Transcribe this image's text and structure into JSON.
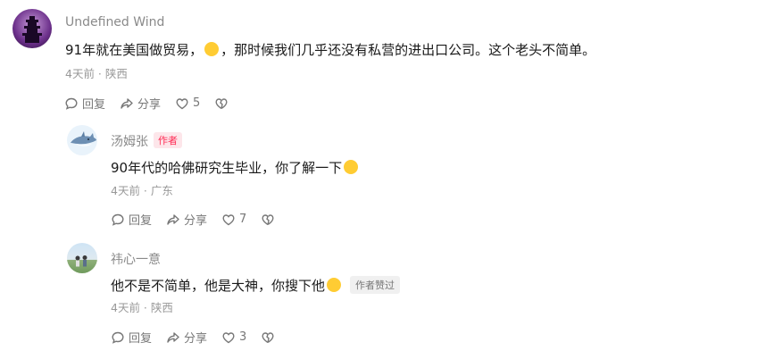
{
  "comments": [
    {
      "name": "Undefined Wind",
      "text_before": "91年就在美国做贸易，",
      "emoji": "laughing-tears-emoji",
      "text_after": "，那时候我们几乎还没有私营的进出口公司。这个老头不简单。",
      "meta": "4天前 · 陕西",
      "reply_label": "回复",
      "share_label": "分享",
      "like_count": "5"
    },
    {
      "name": "汤姆张",
      "author_badge": "作者",
      "text_before": "90年代的哈佛研究生毕业，你了解一下",
      "emoji": "smiling-emoji",
      "meta": "4天前 · 广东",
      "reply_label": "回复",
      "share_label": "分享",
      "like_count": "7"
    },
    {
      "name": "祎心一意",
      "text_before": "他不是不简单，他是大神，你搜下他",
      "emoji": "thinking-emoji",
      "liked_badge": "作者赞过",
      "meta": "4天前 · 陕西",
      "reply_label": "回复",
      "share_label": "分享",
      "like_count": "3"
    }
  ],
  "colors": {
    "author_badge": "#ff2d55",
    "meta": "#999999",
    "name": "#8a8a8a"
  }
}
